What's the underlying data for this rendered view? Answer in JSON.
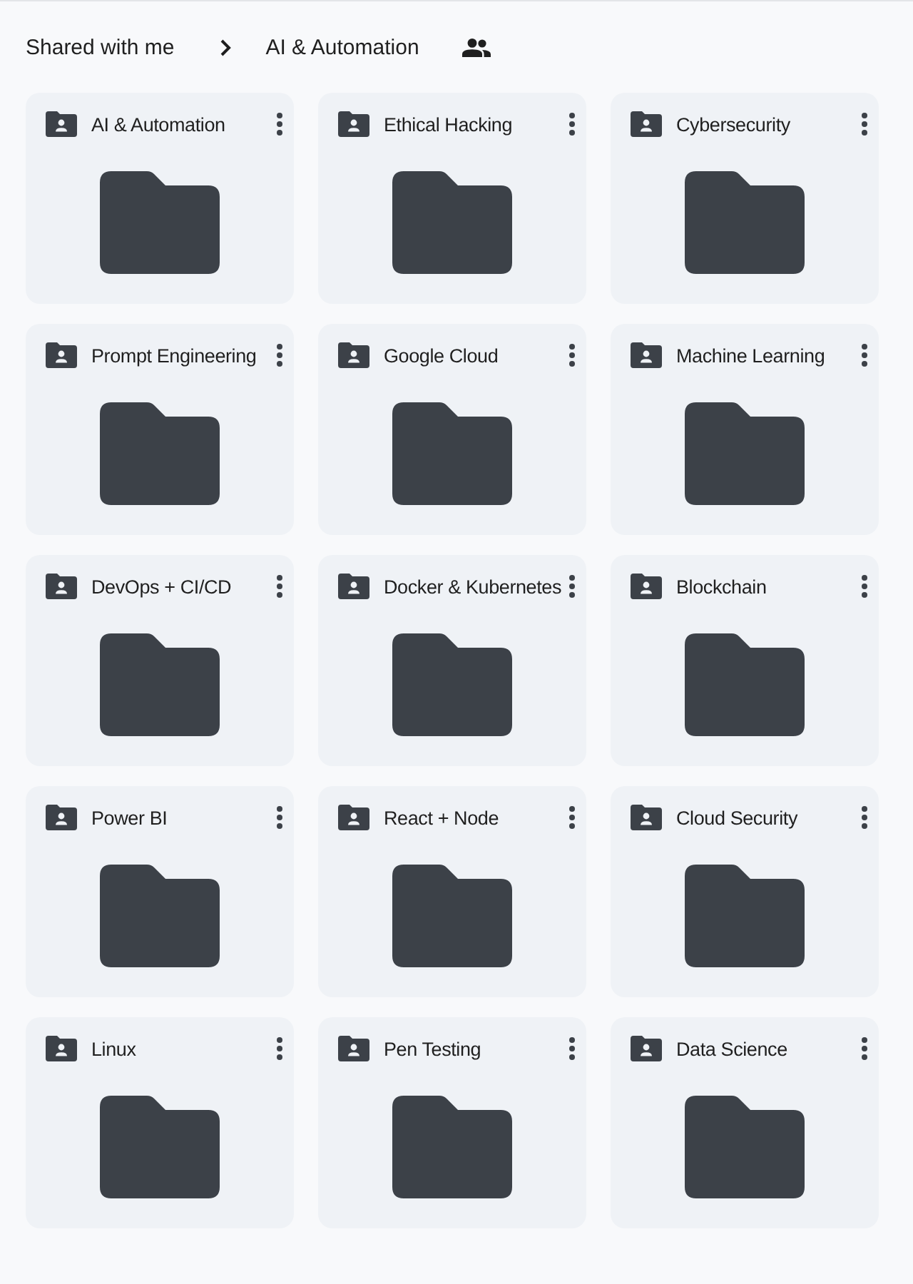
{
  "breadcrumbs": [
    {
      "label": "Shared with me"
    },
    {
      "label": "AI & Automation"
    }
  ],
  "folders": [
    {
      "name": "AI & Automation"
    },
    {
      "name": "Ethical Hacking"
    },
    {
      "name": "Cybersecurity"
    },
    {
      "name": "Prompt Engineering"
    },
    {
      "name": "Google Cloud"
    },
    {
      "name": "Machine Learning"
    },
    {
      "name": "DevOps + CI/CD"
    },
    {
      "name": "Docker & Kubernetes"
    },
    {
      "name": "Blockchain"
    },
    {
      "name": "Power BI"
    },
    {
      "name": "React + Node"
    },
    {
      "name": "Cloud Security"
    },
    {
      "name": "Linux"
    },
    {
      "name": "Pen Testing"
    },
    {
      "name": "Data Science"
    }
  ]
}
